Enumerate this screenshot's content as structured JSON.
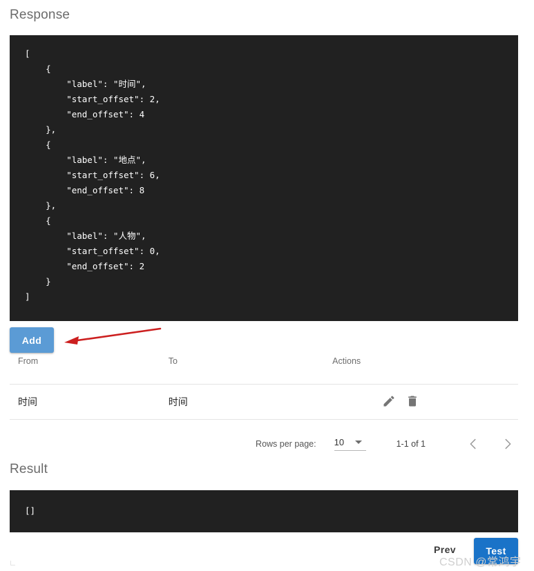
{
  "sections": {
    "response": {
      "title": "Response",
      "code": "[\n    {\n        \"label\": \"时间\",\n        \"start_offset\": 2,\n        \"end_offset\": 4\n    },\n    {\n        \"label\": \"地点\",\n        \"start_offset\": 6,\n        \"end_offset\": 8\n    },\n    {\n        \"label\": \"人物\",\n        \"start_offset\": 0,\n        \"end_offset\": 2\n    }\n]"
    },
    "result": {
      "title": "Result",
      "code": "[]"
    }
  },
  "toolbar": {
    "add_label": "Add"
  },
  "table": {
    "columns": [
      "From",
      "To",
      "Actions"
    ],
    "rows": [
      {
        "from": "时间",
        "to": "时间",
        "actions": [
          "edit-icon",
          "delete-icon"
        ]
      }
    ]
  },
  "pagination": {
    "rows_per_page_label": "Rows per page:",
    "rows_per_page_value": "10",
    "rows_per_page_options": [
      "10"
    ],
    "page_range": "1-1 of 1",
    "prev_page_icon": "chevron-left-icon",
    "next_page_icon": "chevron-right-icon"
  },
  "footer": {
    "prev_label": "Prev",
    "test_label": "Test"
  },
  "annotation": {
    "arrow_color": "#cc1f1f"
  },
  "watermark": {
    "text": "CSDN @常鸿宇"
  },
  "colors": {
    "add_button": "#5b9bd5",
    "test_button": "#1a73c8",
    "code_background": "#212121",
    "section_title": "#6b6b6b"
  }
}
